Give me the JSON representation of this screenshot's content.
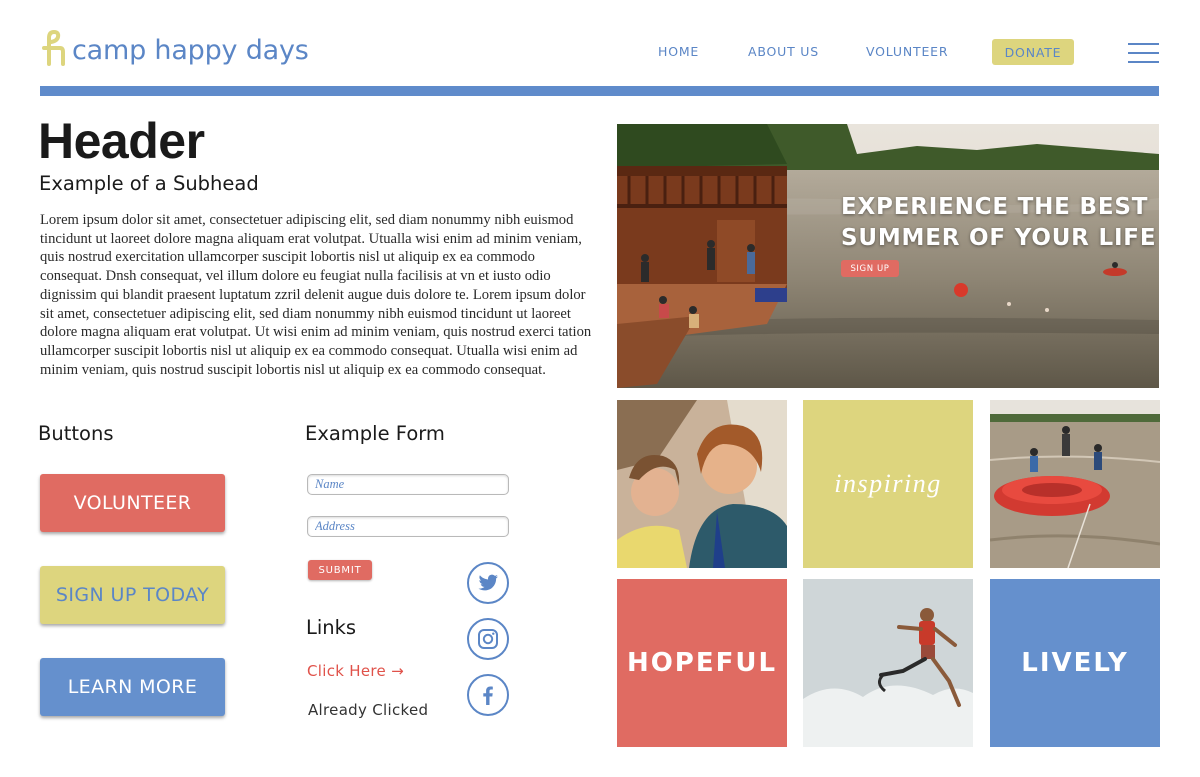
{
  "brand": {
    "name": "camp happy days",
    "logo_icon": "camp-logo-mark",
    "colors": {
      "blue": "#5b86c6",
      "yellow": "#ddd57e",
      "red": "#e06b62"
    }
  },
  "nav": {
    "items": [
      {
        "label": "HOME"
      },
      {
        "label": "ABOUT US"
      },
      {
        "label": "VOLUNTEER"
      }
    ],
    "donate_label": "DONATE",
    "menu_icon": "hamburger-menu-icon"
  },
  "content": {
    "title": "Header",
    "subhead": "Example of a Subhead",
    "body": "Lorem ipsum dolor sit amet, consectetuer adipiscing elit, sed diam nonummy nibh euismod tincidunt ut laoreet dolore magna aliquam erat volutpat. Utualla wisi enim ad minim veniam, quis nostrud exercitation ullamcorper suscipit lobortis nisl ut aliquip ex ea commodo consequat. Dnsh consequat, vel illum dolore eu feugiat nulla facilisis at vn et iusto odio dignissim qui blandit praesent luptatum zzril delenit augue duis dolore te. Lorem ipsum dolor sit amet, consectetuer adipiscing elit, sed diam nonummy nibh euismod tincidunt ut laoreet dolore magna aliquam erat volutpat. Ut wisi enim ad minim veniam, quis nostrud exerci tation ullamcorper suscipit lobortis nisl ut aliquip ex ea commodo consequat. Utualla wisi enim ad minim veniam, quis nostrud suscipit lobortis nisl ut aliquip ex ea commodo consequat."
  },
  "buttons": {
    "heading": "Buttons",
    "volunteer": "VOLUNTEER",
    "sign_up_today": "SIGN UP TODAY",
    "learn_more": "LEARN MORE"
  },
  "form": {
    "heading": "Example Form",
    "name_placeholder": "Name",
    "address_placeholder": "Address",
    "submit_label": "SUBMIT"
  },
  "links": {
    "heading": "Links",
    "click_here": "Click Here →",
    "already_clicked": "Already Clicked"
  },
  "social": [
    "twitter-icon",
    "instagram-icon",
    "facebook-icon"
  ],
  "hero": {
    "headline_line1": "EXPERIENCE THE BEST",
    "headline_line2": "SUMMER OF YOUR LIFE",
    "cta_label": "SIGN UP"
  },
  "tiles": {
    "inspiring": "inspiring",
    "hopeful": "HOPEFUL",
    "lively": "LIVELY"
  }
}
